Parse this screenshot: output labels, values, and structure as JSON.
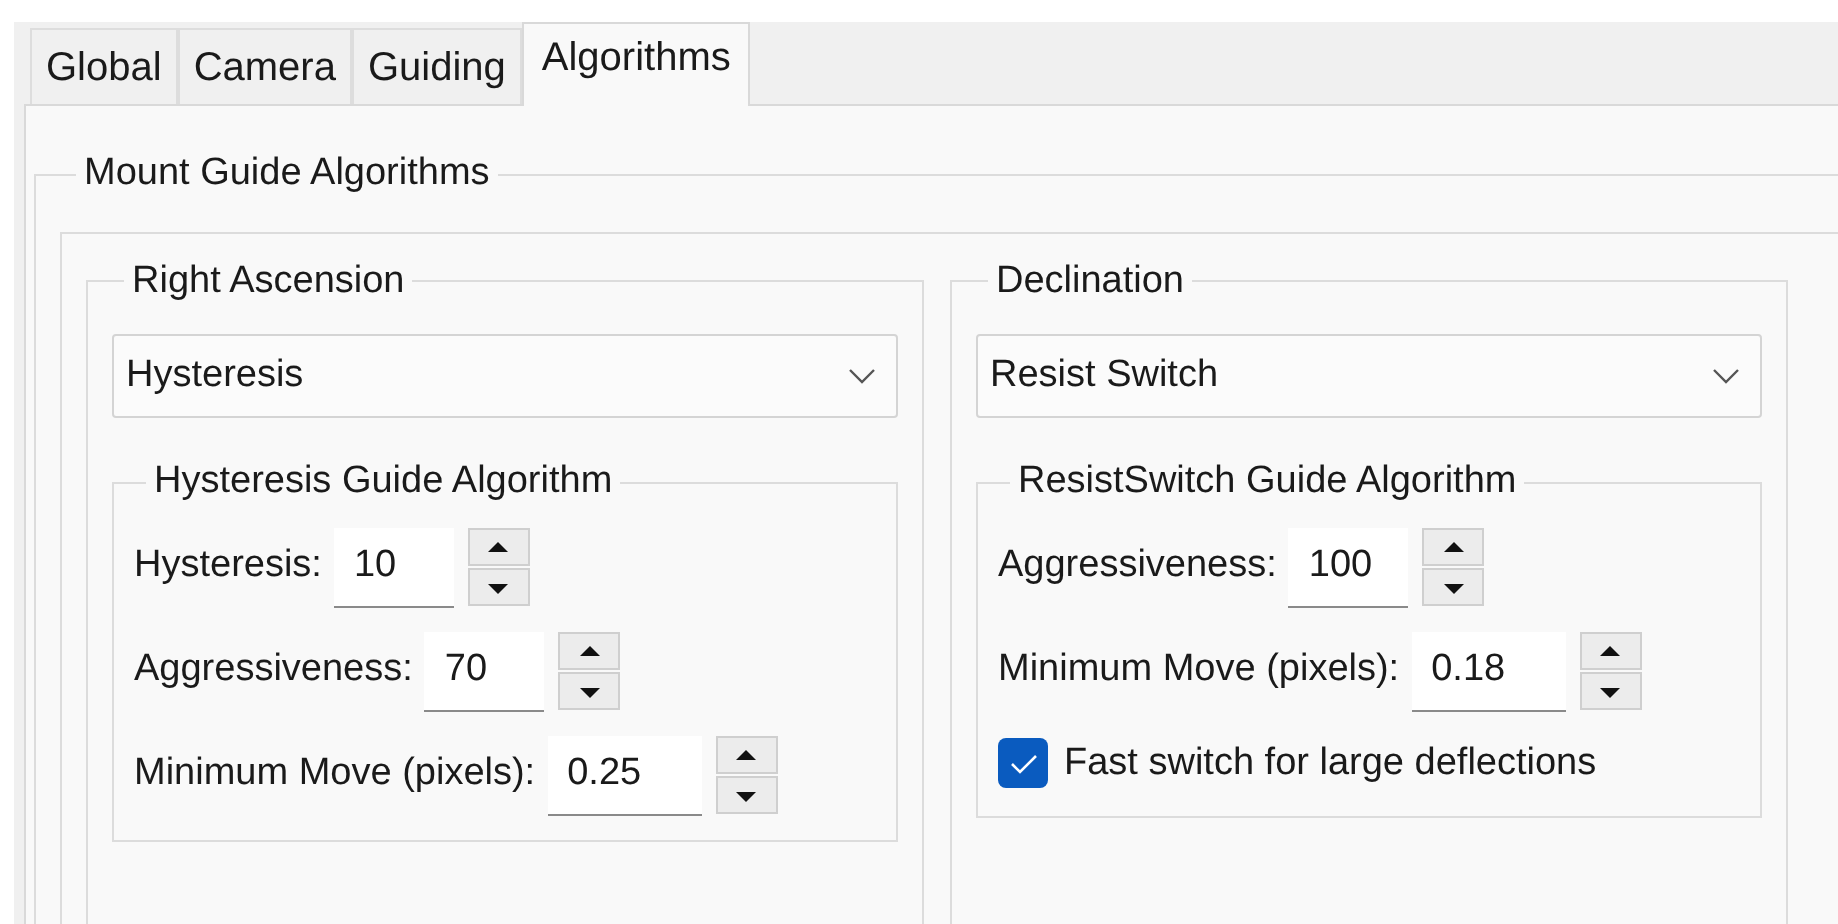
{
  "tabs": [
    {
      "label": "Global",
      "selected": false
    },
    {
      "label": "Camera",
      "selected": false
    },
    {
      "label": "Guiding",
      "selected": false
    },
    {
      "label": "Algorithms",
      "selected": true
    }
  ],
  "group": {
    "title": "Mount Guide Algorithms",
    "axes": [
      {
        "title": "Right Ascension",
        "algorithm": "Hysteresis",
        "settings_title": "Hysteresis Guide Algorithm",
        "fields": [
          {
            "kind": "spin",
            "label": "Hysteresis:",
            "value": "10"
          },
          {
            "kind": "spin",
            "label": "Aggressiveness:",
            "value": "70"
          },
          {
            "kind": "spin",
            "label": "Minimum Move (pixels):",
            "value": "0.25"
          }
        ]
      },
      {
        "title": "Declination",
        "algorithm": "Resist Switch",
        "settings_title": "ResistSwitch Guide Algorithm",
        "fields": [
          {
            "kind": "spin",
            "label": "Aggressiveness:",
            "value": "100"
          },
          {
            "kind": "spin",
            "label": "Minimum Move (pixels):",
            "value": "0.18"
          },
          {
            "kind": "checkbox",
            "label": "Fast switch for large deflections",
            "checked": true
          }
        ]
      }
    ]
  }
}
